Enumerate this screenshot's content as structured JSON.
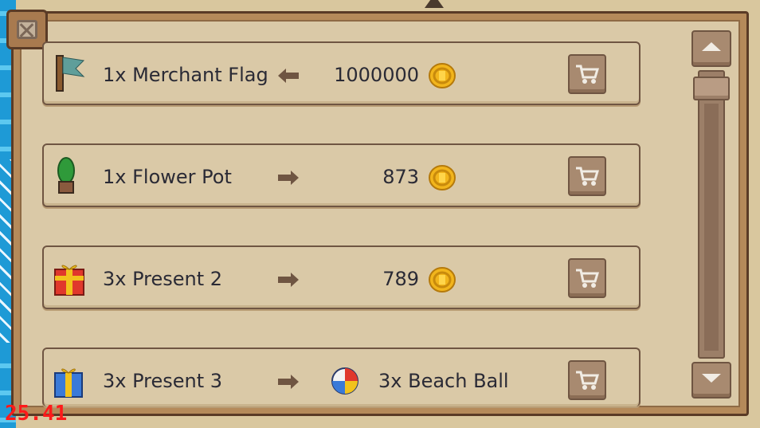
{
  "shop": {
    "rows": [
      {
        "label": "1x Merchant Flag",
        "price": "1000000",
        "icon": "merchant-flag-icon",
        "arrow": "left-arrow-icon"
      },
      {
        "label": "1x Flower Pot",
        "price": "873",
        "icon": "flower-pot-icon",
        "arrow": "right-arrow-icon"
      },
      {
        "label": "3x Present 2",
        "price": "789",
        "icon": "red-present-icon",
        "arrow": "right-arrow-icon"
      },
      {
        "label": "3x Present 3",
        "reward_label": "3x Beach Ball",
        "icon": "blue-present-icon",
        "arrow": "right-arrow-icon",
        "reward_icon": "beach-ball-icon"
      }
    ]
  },
  "hud": {
    "fps": "25.41"
  },
  "icons": {
    "close": "close-icon",
    "coin": "gold-coin-icon",
    "cart": "cart-icon",
    "scroll_up": "up-arrow-icon",
    "scroll_down": "down-arrow-icon"
  },
  "colors": {
    "panel": "#dac9a7",
    "frame": "#b58a5a",
    "border": "#6f5542",
    "fps": "#ff1a1a"
  }
}
